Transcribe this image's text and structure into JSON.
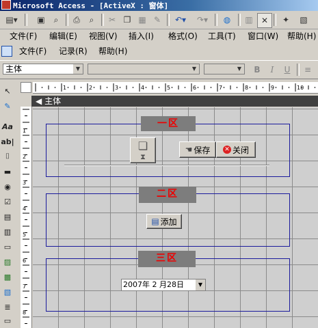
{
  "window": {
    "title": "Microsoft Access - [ActiveX : 窗体]"
  },
  "menu_main": [
    "文件(F)",
    "编辑(E)",
    "视图(V)",
    "插入(I)",
    "格式(O)",
    "工具(T)",
    "窗口(W)",
    "帮助(H)"
  ],
  "menu_sub": [
    "文件(F)",
    "记录(R)",
    "帮助(H)"
  ],
  "format_bar": {
    "object_combo": "主体",
    "bold": "B",
    "italic": "I",
    "underline": "U"
  },
  "toolbox": {
    "label_tool": "Aa",
    "textbox_tool": "ab|"
  },
  "section": {
    "name": "主体"
  },
  "zones": [
    {
      "label": "一区"
    },
    {
      "label": "二区"
    },
    {
      "label": "三区"
    }
  ],
  "buttons": {
    "save": "保存",
    "close": "关闭",
    "add": "添加"
  },
  "date_picker": {
    "value": "2007年 2 月28日"
  },
  "ruler": {
    "h_numbers": [
      "1",
      "2",
      "3",
      "4",
      "5",
      "6",
      "7",
      "8",
      "9",
      "10"
    ],
    "v_numbers": [
      "1",
      "2",
      "3",
      "4",
      "5",
      "6",
      "7",
      "8"
    ]
  }
}
